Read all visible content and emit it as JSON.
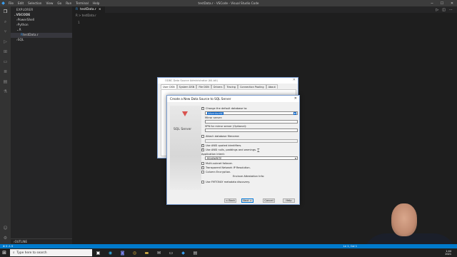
{
  "window_title": "testData.r - VSCode - Visual Studio Code",
  "menu": [
    "File",
    "Edit",
    "Selection",
    "View",
    "Go",
    "Run",
    "Terminal",
    "Help"
  ],
  "explorer": {
    "header": "EXPLORER",
    "section": "VSCODE",
    "items": [
      "PowerShell",
      "Python",
      "R",
      "testData.r",
      "SQL"
    ]
  },
  "outline_label": "OUTLINE",
  "tab": {
    "label": "testData.r",
    "close": "×"
  },
  "breadcrumb": "R > testData.r",
  "editor": {
    "line_number": "1"
  },
  "status": {
    "left": "⊗ 0 ⚠ 0",
    "right": "Ln 1, Col 1"
  },
  "taskbar": {
    "search_placeholder": "Type here to search",
    "time": "1:44",
    "date": "2021"
  },
  "odbc": {
    "title": "ODBC Data Source Administrator (64-bit)",
    "tabs": [
      "User DSN",
      "System DSN",
      "File DSN",
      "Drivers",
      "Tracing",
      "Connection Pooling",
      "About"
    ]
  },
  "dialog": {
    "title": "Create a New Data Source to SQL Server",
    "brand": "SQL Server",
    "change_default_db": "Change the default database to:",
    "default_db_value": "AdventureW",
    "mirror_server_label": "Mirror server:",
    "spn_label": "SPN for mirror server (Optional):",
    "attach_db": "Attach database filename:",
    "ansi_quoted": "Use ANSI quoted identifiers.",
    "ansi_nulls": "Use ANSI nulls, paddings and warnings.",
    "app_intent_label": "Application intent:",
    "app_intent_value": "READWRITE",
    "multi_subnet": "Multi-subnet failover.",
    "transparent_ip": "Transparent Network IP Resolution.",
    "column_encryption": "Column Encryption.",
    "enclave_label": "Enclave Attestation Info:",
    "fmtonly": "Use FMTONLY metadata discovery.",
    "buttons": {
      "back": "< Back",
      "next": "Next >",
      "cancel": "Cancel",
      "help": "Help"
    }
  }
}
